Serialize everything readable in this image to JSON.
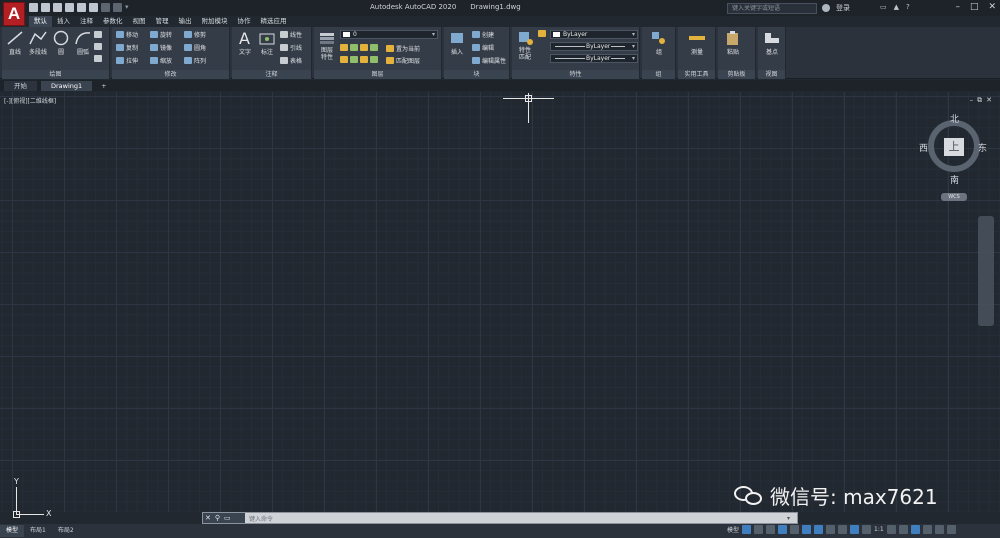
{
  "titlebar": {
    "app_title": "Autodesk AutoCAD 2020",
    "file_name": "Drawing1.dwg",
    "logo_letter": "A",
    "search_placeholder": "键入关键字或短语",
    "login_label": "登录"
  },
  "menu_tabs": [
    "默认",
    "插入",
    "注释",
    "参数化",
    "视图",
    "管理",
    "输出",
    "附加模块",
    "协作",
    "精选应用"
  ],
  "ribbon": {
    "draw": {
      "title": "绘图",
      "line": "直线",
      "polyline": "多段线",
      "circle": "圆",
      "arc": "圆弧"
    },
    "modify": {
      "title": "修改",
      "move": "移动",
      "rotate": "旋转",
      "trim": "修剪",
      "copy": "复制",
      "mirror": "镜像",
      "fillet": "圆角",
      "stretch": "拉伸",
      "scale": "缩放",
      "array": "阵列"
    },
    "annotation": {
      "title": "注释",
      "text": "文字",
      "dimension": "标注",
      "linear": "线性",
      "leader": "引线",
      "table": "表格"
    },
    "layers": {
      "title": "图层",
      "layer_props": "图层\n特性",
      "layer_value": "0",
      "set_current": "置为当前",
      "match_layer": "匹配图层"
    },
    "block": {
      "title": "块",
      "insert": "插入",
      "create": "创建",
      "edit": "编辑",
      "edit_attr": "编辑属性"
    },
    "properties": {
      "title": "特性",
      "match": "特性\n匹配",
      "color": "ByLayer",
      "linetype": "ByLayer",
      "lineweight": "ByLayer"
    },
    "groups": {
      "title": "组",
      "group": "组"
    },
    "utilities": {
      "title": "实用工具",
      "measure": "测量"
    },
    "clipboard": {
      "title": "剪贴板",
      "paste": "粘贴"
    },
    "view": {
      "title": "视图",
      "base": "基点"
    }
  },
  "file_tabs": [
    "开始",
    "Drawing1",
    "+"
  ],
  "viewport": {
    "label": "[-][俯视][二维线框]",
    "viewcube": {
      "north": "北",
      "south": "南",
      "west": "西",
      "east": "东",
      "face": "上",
      "wcs": "WCS"
    },
    "ucs": {
      "x": "X",
      "y": "Y"
    }
  },
  "watermark": "微信号: max7621",
  "command": {
    "placeholder": "键入命令"
  },
  "layout_tabs": [
    "模型",
    "布局1",
    "布局2"
  ],
  "status": {
    "model": "模型",
    "scale": "1:1"
  }
}
